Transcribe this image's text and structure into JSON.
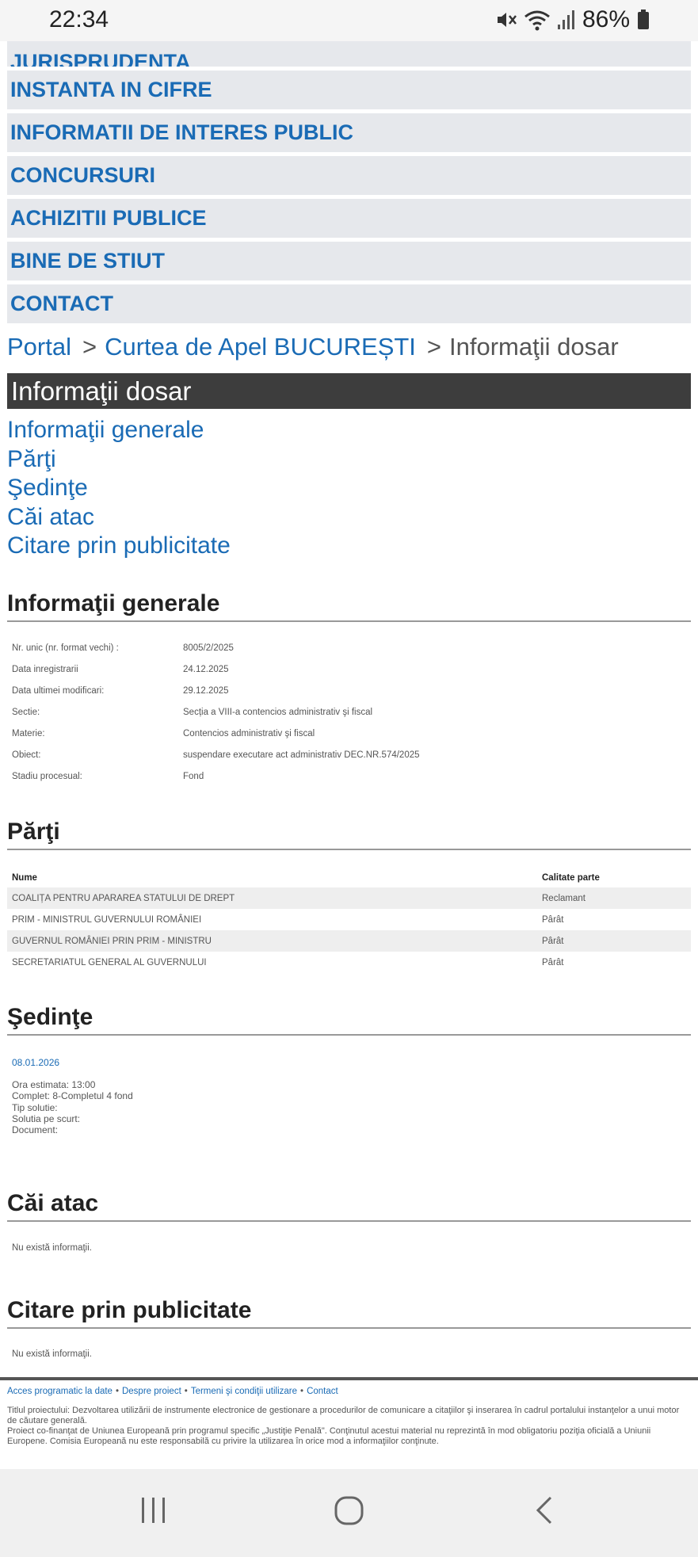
{
  "status_bar": {
    "time": "22:34",
    "battery": "86%",
    "icons": [
      "mute-icon",
      "wifi-icon",
      "signal-icon",
      "battery-icon"
    ]
  },
  "menu": {
    "items": [
      {
        "label": "JURISPRUDENTA"
      },
      {
        "label": "INSTANTA IN CIFRE"
      },
      {
        "label": "INFORMATII DE INTERES PUBLIC"
      },
      {
        "label": "CONCURSURI"
      },
      {
        "label": "ACHIZITII PUBLICE"
      },
      {
        "label": "BINE DE STIUT"
      },
      {
        "label": "CONTACT"
      }
    ]
  },
  "breadcrumb": {
    "portal": "Portal",
    "court": "Curtea de Apel BUCUREȘTI",
    "current": "Informaţii dosar",
    "separator": ">"
  },
  "page_title": "Informaţii dosar",
  "quick_links": [
    "Informaţii generale",
    "Părţi",
    "Şedinţe",
    "Căi atac",
    "Citare prin publicitate"
  ],
  "general_info": {
    "heading": "Informaţii generale",
    "rows": [
      {
        "label": "Nr. unic (nr. format vechi) :",
        "value": "8005/2/2025"
      },
      {
        "label": "Data inregistrarii",
        "value": "24.12.2025"
      },
      {
        "label": "Data ultimei modificari:",
        "value": "29.12.2025"
      },
      {
        "label": "Sectie:",
        "value": "Secția a VIII-a contencios administrativ şi fiscal"
      },
      {
        "label": "Materie:",
        "value": "Contencios administrativ şi fiscal"
      },
      {
        "label": "Obiect:",
        "value": "suspendare executare act administrativ DEC.NR.574/2025"
      },
      {
        "label": "Stadiu procesual:",
        "value": "Fond"
      }
    ]
  },
  "parti": {
    "heading": "Părţi",
    "columns": [
      "Nume",
      "Calitate parte"
    ],
    "rows": [
      {
        "name": "COALIȚA PENTRU APARAREA STATULUI DE DREPT",
        "role": "Reclamant"
      },
      {
        "name": "PRIM - MINISTRUL GUVERNULUI ROMÂNIEI",
        "role": "Pârât"
      },
      {
        "name": "GUVERNUL ROMÂNIEI PRIN PRIM - MINISTRU",
        "role": "Pârât"
      },
      {
        "name": "SECRETARIATUL GENERAL AL GUVERNULUI",
        "role": "Pârât"
      }
    ]
  },
  "sedinte": {
    "heading": "Şedinţe",
    "date": "08.01.2026",
    "details": [
      "Ora estimata: 13:00",
      "Complet: 8-Completul 4 fond",
      "Tip solutie:",
      "Solutia pe scurt:",
      "Document:"
    ]
  },
  "cai_atac": {
    "heading": "Căi atac",
    "text": "Nu există informaţii."
  },
  "citare": {
    "heading": "Citare prin publicitate",
    "text": "Nu există informaţii."
  },
  "footer": {
    "links": [
      "Acces programatic la date",
      "Despre proiect",
      "Termeni şi condiţii utilizare",
      "Contact"
    ],
    "line1": "Titlul proiectului: Dezvoltarea utilizării de instrumente electronice de gestionare a procedurilor de comunicare a citaţiilor şi inserarea în cadrul portalului instanţelor a unui motor de căutare generală.",
    "line2": "Proiect co-finanţat de Uniunea Europeană prin programul specific „Justiţie Penală\". Conţinutul acestui material nu reprezintă în mod obligatoriu poziţia oficială a Uniunii Europene. Comisia Europeană nu este responsabilă cu privire la utilizarea în orice mod a informaţiilor conţinute."
  },
  "nav_bar": {
    "icons": [
      "recents-icon",
      "home-icon",
      "back-icon"
    ]
  }
}
